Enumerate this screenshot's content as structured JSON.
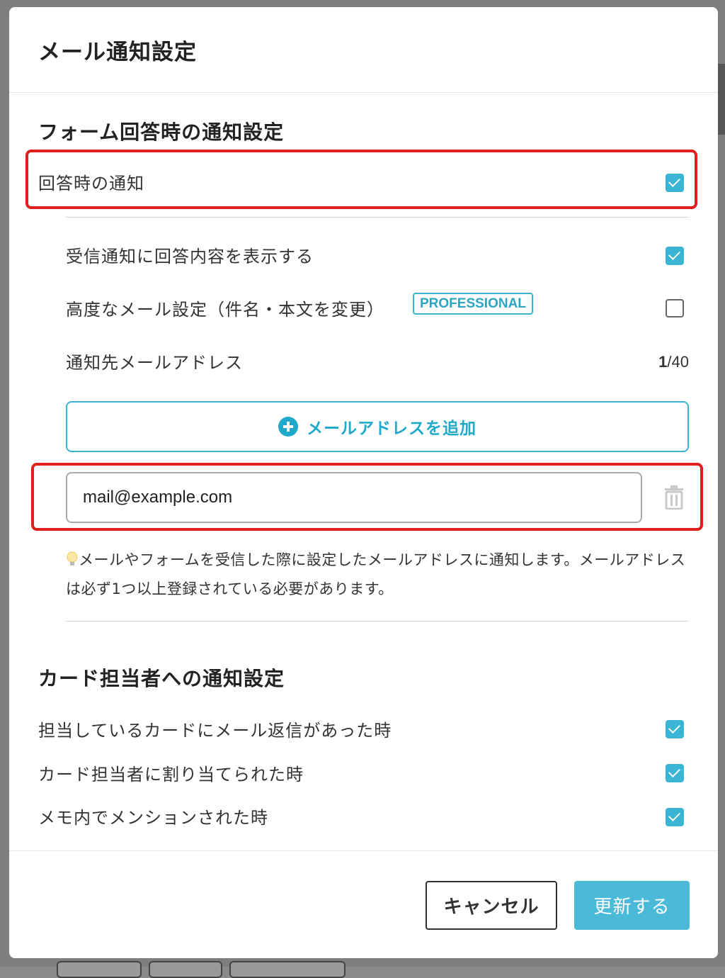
{
  "modal": {
    "title": "メール通知設定"
  },
  "form_section": {
    "title": "フォーム回答時の通知設定",
    "answer_notify": {
      "label": "回答時の通知",
      "checked": true
    },
    "show_content": {
      "label": "受信通知に回答内容を表示する",
      "checked": true
    },
    "advanced": {
      "label": "高度なメール設定（件名・本文を変更）",
      "badge": "PROFESSIONAL",
      "checked": false
    },
    "recipients": {
      "label": "通知先メールアドレス",
      "count": "1",
      "max": "/40",
      "add_label": "メールアドレスを追加",
      "email_value": "mail@example.com"
    },
    "help_text": "メールやフォームを受信した際に設定したメールアドレスに通知します。メールアドレスは必ず1つ以上登録されている必要があります。"
  },
  "card_section": {
    "title": "カード担当者への通知設定",
    "items": [
      {
        "label": "担当しているカードにメール返信があった時",
        "checked": true
      },
      {
        "label": "カード担当者に割り当てられた時",
        "checked": true
      },
      {
        "label": "メモ内でメンションされた時",
        "checked": true
      }
    ]
  },
  "footer": {
    "cancel_label": "キャンセル",
    "submit_label": "更新する"
  },
  "colors": {
    "accent": "#3ab5d4",
    "highlight": "#e0201c",
    "submit_bg": "#4bbad8"
  }
}
